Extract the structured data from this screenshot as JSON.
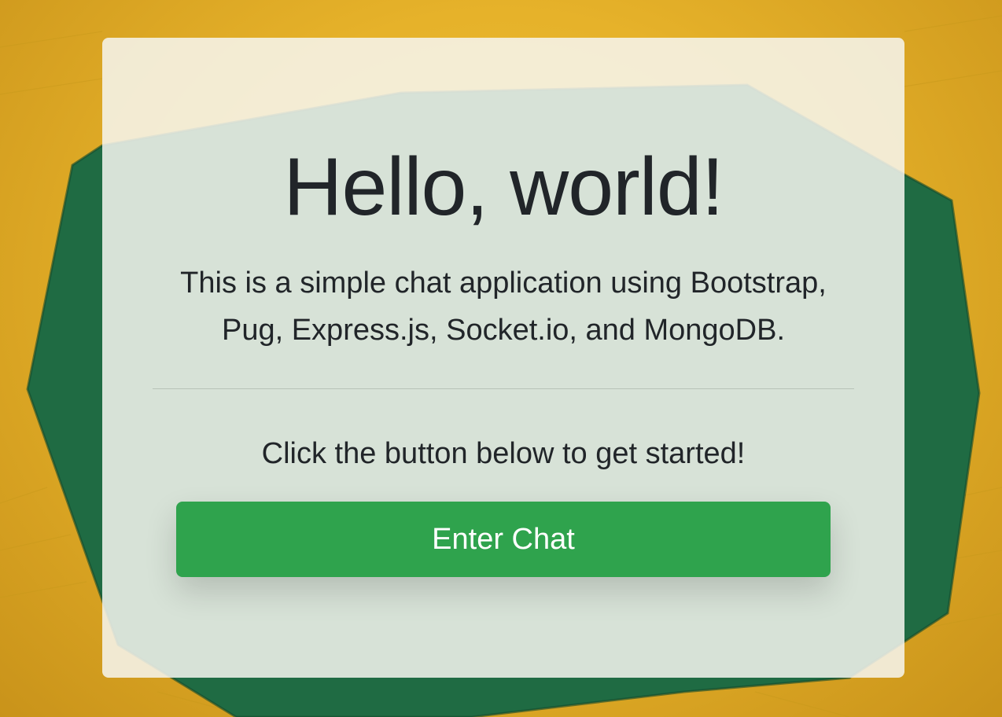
{
  "hero": {
    "title": "Hello, world!",
    "lead": "This is a simple chat application using Bootstrap, Pug, Express.js, Socket.io, and MongoDB.",
    "cta_text": "Click the button below to get started!",
    "button_label": "Enter Chat"
  },
  "colors": {
    "background_yellow": "#e6b22a",
    "background_green": "#1f6b43",
    "button_green": "#2fa34d",
    "text_dark": "#212529"
  }
}
